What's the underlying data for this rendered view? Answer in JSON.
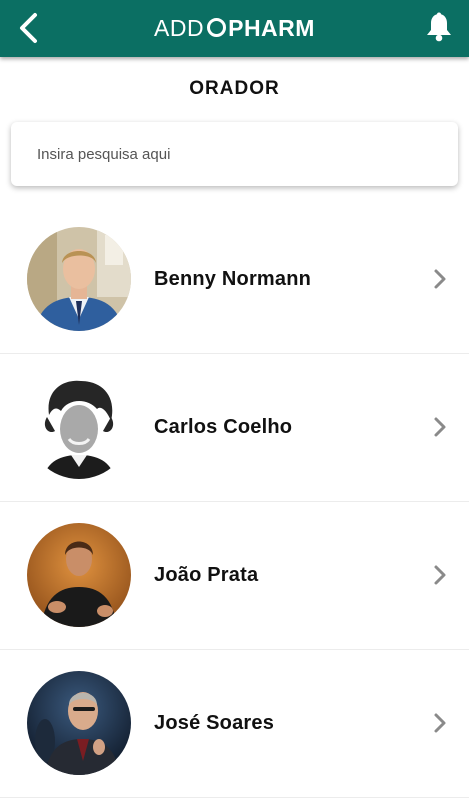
{
  "header": {
    "brand_light": "ADD",
    "brand_bold": "PHARM",
    "back_icon": "chevron-left-icon",
    "bell_icon": "bell-icon",
    "color": "#0b6f63"
  },
  "page": {
    "title": "ORADOR"
  },
  "search": {
    "placeholder": "Insira pesquisa aqui",
    "value": ""
  },
  "speakers": [
    {
      "name": "Benny Normann"
    },
    {
      "name": "Carlos Coelho"
    },
    {
      "name": "João Prata"
    },
    {
      "name": "José Soares"
    }
  ]
}
